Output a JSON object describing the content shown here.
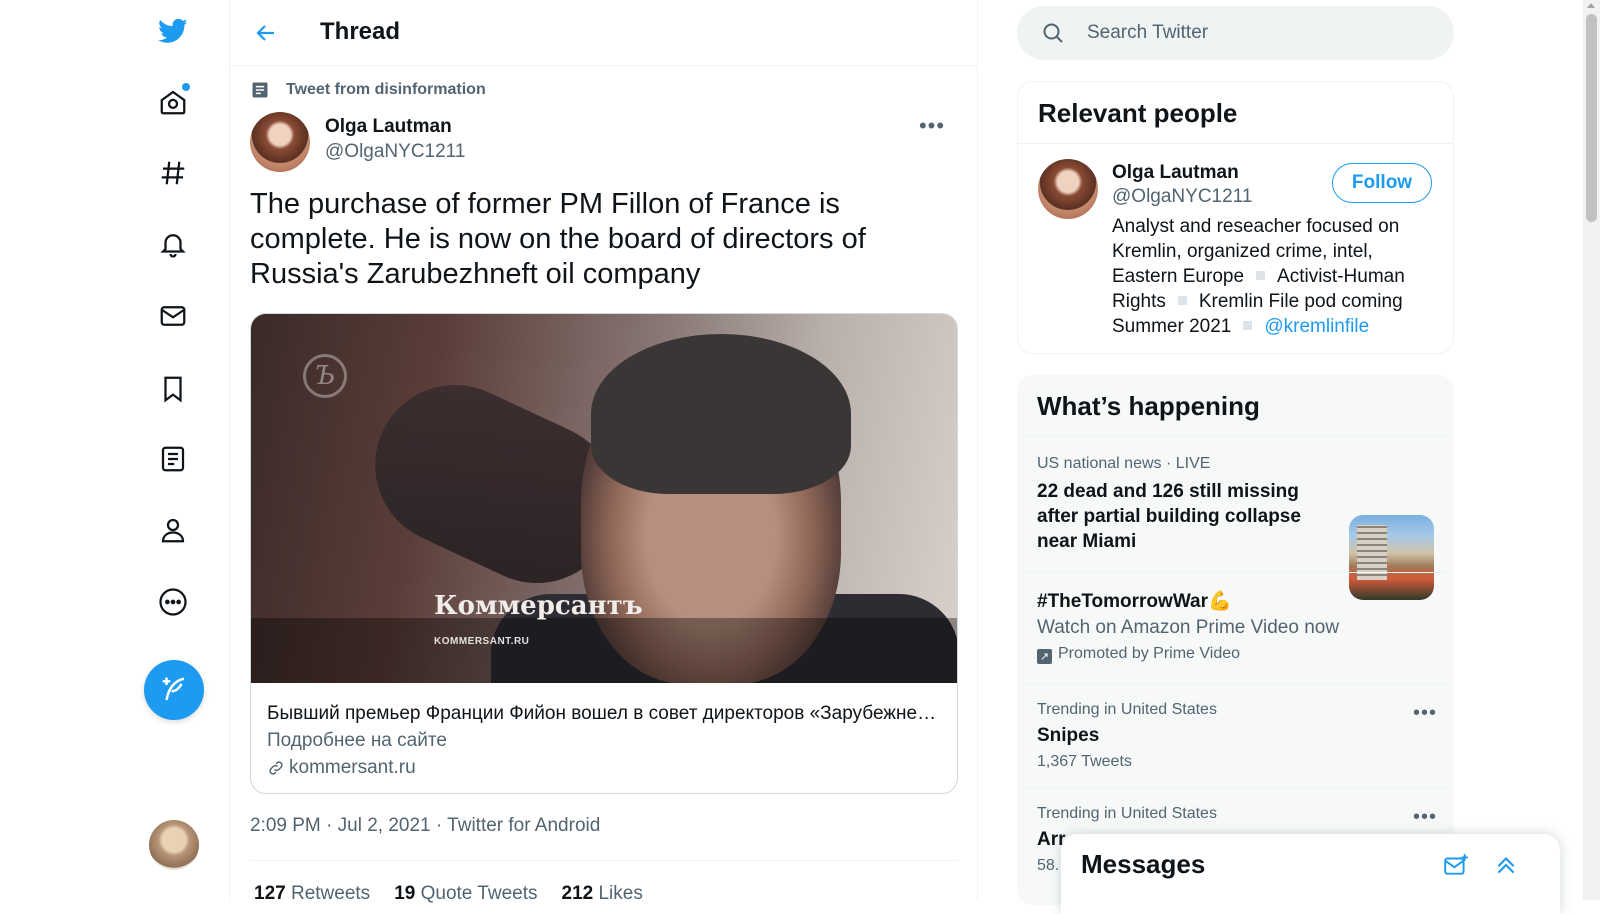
{
  "nav": {
    "items": [
      "home",
      "explore",
      "notifications",
      "messages",
      "bookmarks",
      "lists",
      "profile",
      "more"
    ]
  },
  "header": {
    "title": "Thread"
  },
  "tweet": {
    "context_label": "Tweet from disinformation",
    "author_name": "Olga Lautman",
    "author_handle": "@OlgaNYC1211",
    "more_label": "•••",
    "text": "The purchase of former PM Fillon of France is complete. He is now on the board of directors of Russia's Zarubezhneft oil company",
    "card": {
      "image_mark": "Ъ",
      "image_brand": "Коммерсантъ",
      "image_brand_url": "KOMMERSANT.RU",
      "title": "Бывший премьер Франции Фийон вошел в совет директоров «Зарубежнефти»",
      "description": "Подробнее на сайте",
      "domain": "kommersant.ru"
    },
    "time": "2:09 PM",
    "date": "Jul 2, 2021",
    "source": "Twitter for Android",
    "meta_sep": "·",
    "retweets_count": "127",
    "retweets_label": "Retweets",
    "quotes_count": "19",
    "quotes_label": "Quote Tweets",
    "likes_count": "212",
    "likes_label": "Likes"
  },
  "search": {
    "placeholder": "Search Twitter"
  },
  "relevant_people": {
    "title": "Relevant people",
    "person": {
      "name": "Olga Lautman",
      "handle": "@OlgaNYC1211",
      "follow_label": "Follow",
      "bio_1": "Analyst and reseacher focused on Kremlin, organized crime, intel, Eastern Europe",
      "bio_2": "Activist-Human Rights",
      "bio_3": "Kremlin File pod coming Summer 2021",
      "bio_mention": "@kremlinfile"
    }
  },
  "happening": {
    "title": "What’s happening",
    "trends": [
      {
        "meta": "US national news · LIVE",
        "title": "22 dead and 126 still missing after partial building collapse near Miami"
      },
      {
        "title": "#TheTomorrowWar💪",
        "subtitle": "Watch on Amazon Prime Video now",
        "promo": "Promoted by Prime Video"
      },
      {
        "meta": "Trending in United States",
        "title": "Snipes",
        "count": "1,367 Tweets"
      },
      {
        "meta": "Trending in United States",
        "title": "Arr",
        "count": "58."
      }
    ]
  },
  "messages": {
    "title": "Messages"
  },
  "colors": {
    "accent": "#1d9bf0",
    "text": "#0f1419",
    "secondary": "#536471"
  }
}
